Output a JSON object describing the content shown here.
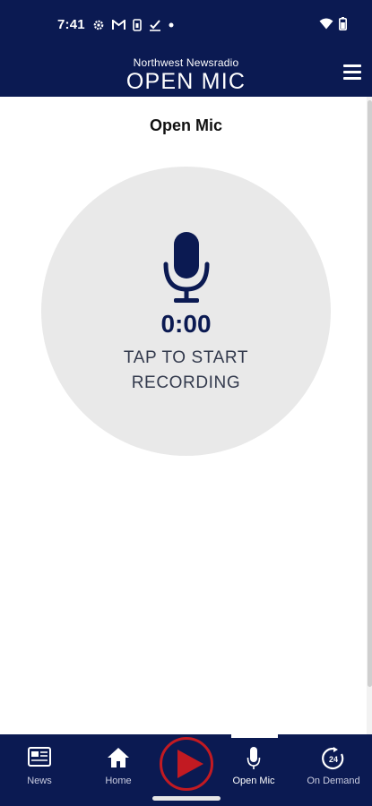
{
  "status_bar": {
    "time": "7:41"
  },
  "header": {
    "brand_subtitle": "Northwest Newsradio",
    "brand_title": "OPEN MIC"
  },
  "page": {
    "title": "Open Mic"
  },
  "recorder": {
    "timer": "0:00",
    "prompt": "TAP TO START\nRECORDING"
  },
  "bottom_nav": {
    "items": [
      {
        "label": "News",
        "icon": "newspaper-icon"
      },
      {
        "label": "Home",
        "icon": "home-icon"
      },
      {
        "label": "Open Mic",
        "icon": "microphone-icon",
        "active": true
      },
      {
        "label": "On Demand",
        "icon": "on-demand-24-icon"
      }
    ],
    "play_icon": "play-icon"
  },
  "colors": {
    "brand_navy": "#0b1a52",
    "play_ring_red": "#c21a22",
    "record_circle_bg": "#e9e9e9"
  }
}
